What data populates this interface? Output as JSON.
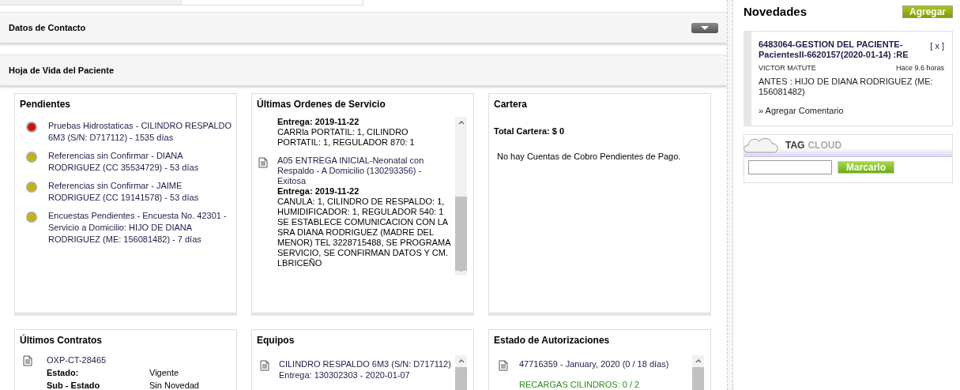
{
  "sections": [
    {
      "title": "Datos de Contacto",
      "expandable": true
    },
    {
      "title": "Hoja de Vida del Paciente",
      "expandable": false
    }
  ],
  "pendientes": {
    "title": "Pendientes",
    "items": [
      {
        "text": "Pruebas Hidrostaticas - CILINDRO RESPALDO 6M3 (S/N: D717112) - 1535 días",
        "color": "#cc1111"
      },
      {
        "text": "Referencias sin Confirmar - DIANA RODRIGUEZ (CC 35534729) - 53 días",
        "color": "#c8b400"
      },
      {
        "text": "Referencias sin Confirmar - JAIME RODRIGUEZ (CC 19141578) - 53 días",
        "color": "#c8b400"
      },
      {
        "text": "Encuestas Pendientes - Encuesta No. 42301 - Servicio a Domicilio: HIJO DE DIANA RODRIGUEZ (ME: 156081482) - 7 días",
        "color": "#c8b400"
      }
    ]
  },
  "ordenes": {
    "title": "Últimas Ordenes de Servicio",
    "items": [
      {
        "entrega": "Entrega: 2019-11-22",
        "lines": [
          "CARRla PORTATIL: 1, CILINDRO PORTATIL: 1, REGULADOR 870: 1"
        ]
      },
      {
        "title": "A05 ENTREGA INICIAL-Neonatal con Respaldo - A Domicilio (130293356) - Exitosa",
        "entrega": "Entrega: 2019-11-22",
        "lines": [
          "CANULA: 1, CILINDRO DE RESPALDO: 1, HUMIDIFICADOR: 1, REGULADOR 540: 1",
          "SE ESTABLECE COMUNICACION CON LA SRA DIANA RODRIGUEZ (MADRE DEL MENOR) TEL  3228715488, SE PROGRAMA SERVICIO, SE CONFIRMAN DATOS Y CM. LBRICEÑO"
        ]
      }
    ]
  },
  "cartera": {
    "title": "Cartera",
    "total": "Total Cartera: $ 0",
    "message": "No hay Cuentas de Cobro Pendientes de Pago."
  },
  "contratos": {
    "title": "Últimos Contratos",
    "items": [
      {
        "code": "OXP-CT-28465",
        "fields": [
          {
            "label": "Estado:",
            "value": "Vigente"
          },
          {
            "label": "Sub - Estado",
            "value": "Sin Novedad"
          }
        ]
      }
    ]
  },
  "equipos": {
    "title": "Equipos",
    "items": [
      {
        "name": "CILINDRO RESPALDO 6M3 (S/N: D717112)",
        "entrega": "Entrega: 130302303 - 2020-01-07"
      }
    ]
  },
  "autorizaciones": {
    "title": "Estado de Autorizaciones",
    "items": [
      {
        "name": "47716359 - January, 2020 (0 / 18 días)",
        "lines": [
          "RECARGAS CILINDROS: 0 / 2"
        ]
      }
    ]
  },
  "novedades": {
    "title": "Novedades",
    "add_button": "Agregar",
    "items": [
      {
        "title": "6483064-GESTION DEL PACIENTE-PacientesII-6620157(2020-01-14) :RE",
        "close": "[ x ]",
        "author": "VICTOR MATUTE",
        "time": "Hace 9.6 horas",
        "body": "ANTES : HIJO DE DIANA RODRIGUEZ (ME: 156081482)",
        "comment_link": "» Agregar Comentario"
      }
    ]
  },
  "tag_cloud": {
    "title_a": "TAG",
    "title_b": "CLOUD",
    "button": "Marcarlo"
  }
}
